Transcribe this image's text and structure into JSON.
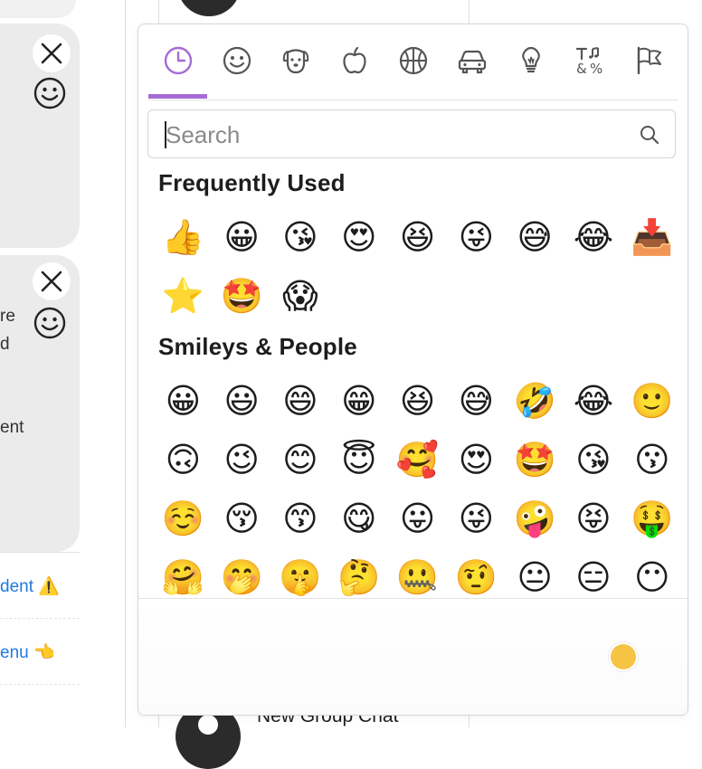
{
  "background": {
    "cards": [
      {
        "text_lines": []
      },
      {
        "text_lines": [
          "re",
          "d",
          "ent"
        ]
      }
    ],
    "links": [
      {
        "label": "dent ⚠️"
      },
      {
        "label": "enu 👈"
      }
    ],
    "new_group_label": "New Group Chat"
  },
  "picker": {
    "accent_color": "#a56bd6",
    "categories": [
      {
        "icon": "clock-icon",
        "active": true
      },
      {
        "icon": "smiley-icon"
      },
      {
        "icon": "dog-icon"
      },
      {
        "icon": "apple-icon"
      },
      {
        "icon": "basketball-icon"
      },
      {
        "icon": "car-icon"
      },
      {
        "icon": "lightbulb-icon"
      },
      {
        "icon": "symbols-icon"
      },
      {
        "icon": "flags-icon"
      }
    ],
    "search": {
      "placeholder": "Search",
      "value": ""
    },
    "sections": [
      {
        "title": "Frequently Used",
        "emojis": [
          "👍",
          "😀",
          "😘",
          "😍",
          "😆",
          "😜",
          "😅",
          "😂",
          "📥",
          "⭐",
          "🤩",
          "😱"
        ]
      },
      {
        "title": "Smileys & People",
        "emojis": [
          "😀",
          "😃",
          "😄",
          "😁",
          "😆",
          "😅",
          "🤣",
          "😂",
          "🙂",
          "🙃",
          "😉",
          "😊",
          "😇",
          "🥰",
          "😍",
          "🤩",
          "😘",
          "😗",
          "☺️",
          "😚",
          "😙",
          "😋",
          "😛",
          "😜",
          "🤪",
          "😝",
          "🤑",
          "🤗",
          "🤭",
          "🤫",
          "🤔",
          "🤐",
          "🤨",
          "😐",
          "😑",
          "😶"
        ]
      }
    ],
    "skin_tone_color": "#f6c343"
  }
}
